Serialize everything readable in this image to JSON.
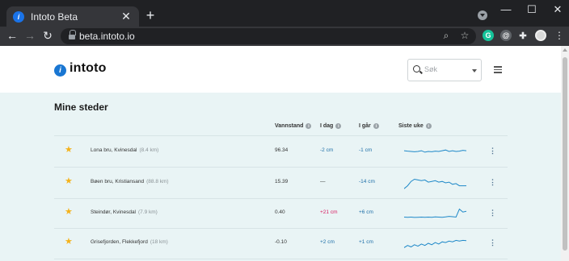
{
  "browser": {
    "tab_title": "Intoto Beta",
    "tab_close": "✕",
    "new_tab": "+",
    "url": "beta.intoto.io",
    "window_min": "—",
    "window_max": "☐",
    "window_close": "✕",
    "extensions": [
      {
        "icon": "grammarly-icon",
        "glyph": "G",
        "color": "#15c39a"
      },
      {
        "icon": "at-icon",
        "glyph": "@",
        "color": "#5f6368"
      }
    ]
  },
  "site": {
    "logo_text": "intoto",
    "search": {
      "placeholder": "Søk"
    },
    "section_title": "Mine steder",
    "columns": {
      "level": "Vannstand",
      "today": "I dag",
      "yesterday": "I går",
      "week": "Siste uke"
    },
    "colors": {
      "positive": "#d81b60",
      "negative": "#1e6fa8",
      "star": "#f4b21b",
      "spark": "#1e88c8"
    },
    "rows": [
      {
        "place": "Lona bru, Kvinesdal",
        "distance": "(8.4 km)",
        "level": "96.34",
        "today": "-2 cm",
        "today_color": "#1e6fa8",
        "yesterday": "-1 cm",
        "yesterday_color": "#1e6fa8",
        "spark": [
          0.55,
          0.52,
          0.5,
          0.48,
          0.5,
          0.55,
          0.45,
          0.5,
          0.48,
          0.52,
          0.5,
          0.55,
          0.6,
          0.5,
          0.55,
          0.5,
          0.52,
          0.58,
          0.55
        ]
      },
      {
        "place": "Bøen bru, Kristiansand",
        "distance": "(88.8 km)",
        "level": "15.39",
        "today": "—",
        "today_color": "#333333",
        "yesterday": "-14 cm",
        "yesterday_color": "#1e6fa8",
        "spark": [
          0.1,
          0.3,
          0.6,
          0.75,
          0.7,
          0.65,
          0.7,
          0.55,
          0.6,
          0.65,
          0.55,
          0.6,
          0.5,
          0.55,
          0.4,
          0.45,
          0.3,
          0.3,
          0.3
        ]
      },
      {
        "place": "Steindør, Kvinesdal",
        "distance": "(7.9 km)",
        "level": "0.40",
        "today": "+21 cm",
        "today_color": "#d81b60",
        "yesterday": "+6 cm",
        "yesterday_color": "#1e6fa8",
        "spark": [
          0.25,
          0.24,
          0.25,
          0.23,
          0.24,
          0.25,
          0.24,
          0.25,
          0.24,
          0.26,
          0.25,
          0.24,
          0.26,
          0.3,
          0.28,
          0.25,
          0.8,
          0.6,
          0.65
        ]
      },
      {
        "place": "Grisefjorden, Flekkefjord",
        "distance": "(18 km)",
        "level": "-0.10",
        "today": "+2 cm",
        "today_color": "#1e6fa8",
        "yesterday": "+1 cm",
        "yesterday_color": "#1e6fa8",
        "spark": [
          0.2,
          0.35,
          0.25,
          0.4,
          0.3,
          0.45,
          0.35,
          0.5,
          0.4,
          0.55,
          0.45,
          0.6,
          0.55,
          0.65,
          0.6,
          0.7,
          0.65,
          0.7,
          0.68
        ]
      }
    ]
  }
}
